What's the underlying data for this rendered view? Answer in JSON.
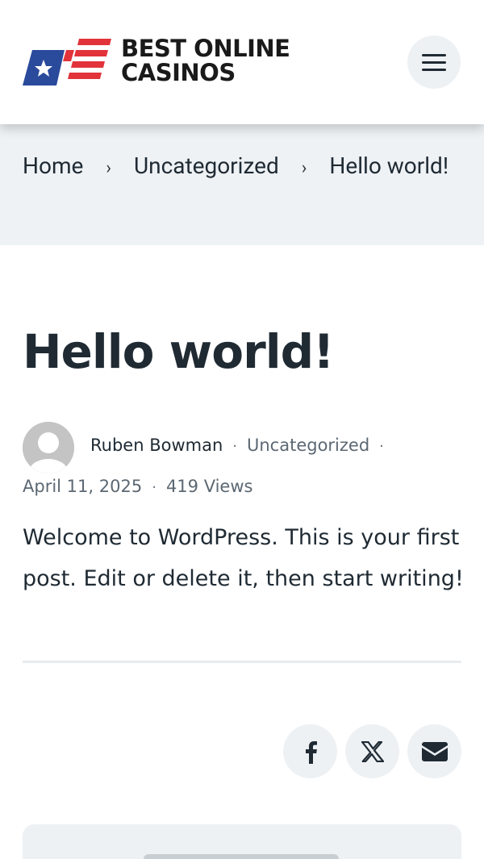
{
  "header": {
    "logo_line1": "BEST ONLINE",
    "logo_line2": "CASINOS",
    "menu_icon": "hamburger-menu-icon"
  },
  "breadcrumb": {
    "items": [
      "Home",
      "Uncategorized",
      "Hello world!"
    ],
    "separator": "›"
  },
  "post": {
    "title": "Hello world!",
    "author": "Ruben Bowman",
    "category": "Uncategorized",
    "date": "April 11, 2025",
    "views": "419 Views",
    "meta_separator": "·",
    "body": "Welcome to WordPress. This is your first post. Edit or delete it, then start writing!"
  },
  "share": {
    "icons": [
      "facebook-icon",
      "x-icon",
      "email-icon"
    ]
  },
  "colors": {
    "text": "#1f2a33",
    "muted": "#5c6873",
    "breadcrumb_bg": "#eef2f5",
    "button_bg": "#eef1f4",
    "logo_blue": "#2a4a9c",
    "logo_red": "#e2333b"
  }
}
